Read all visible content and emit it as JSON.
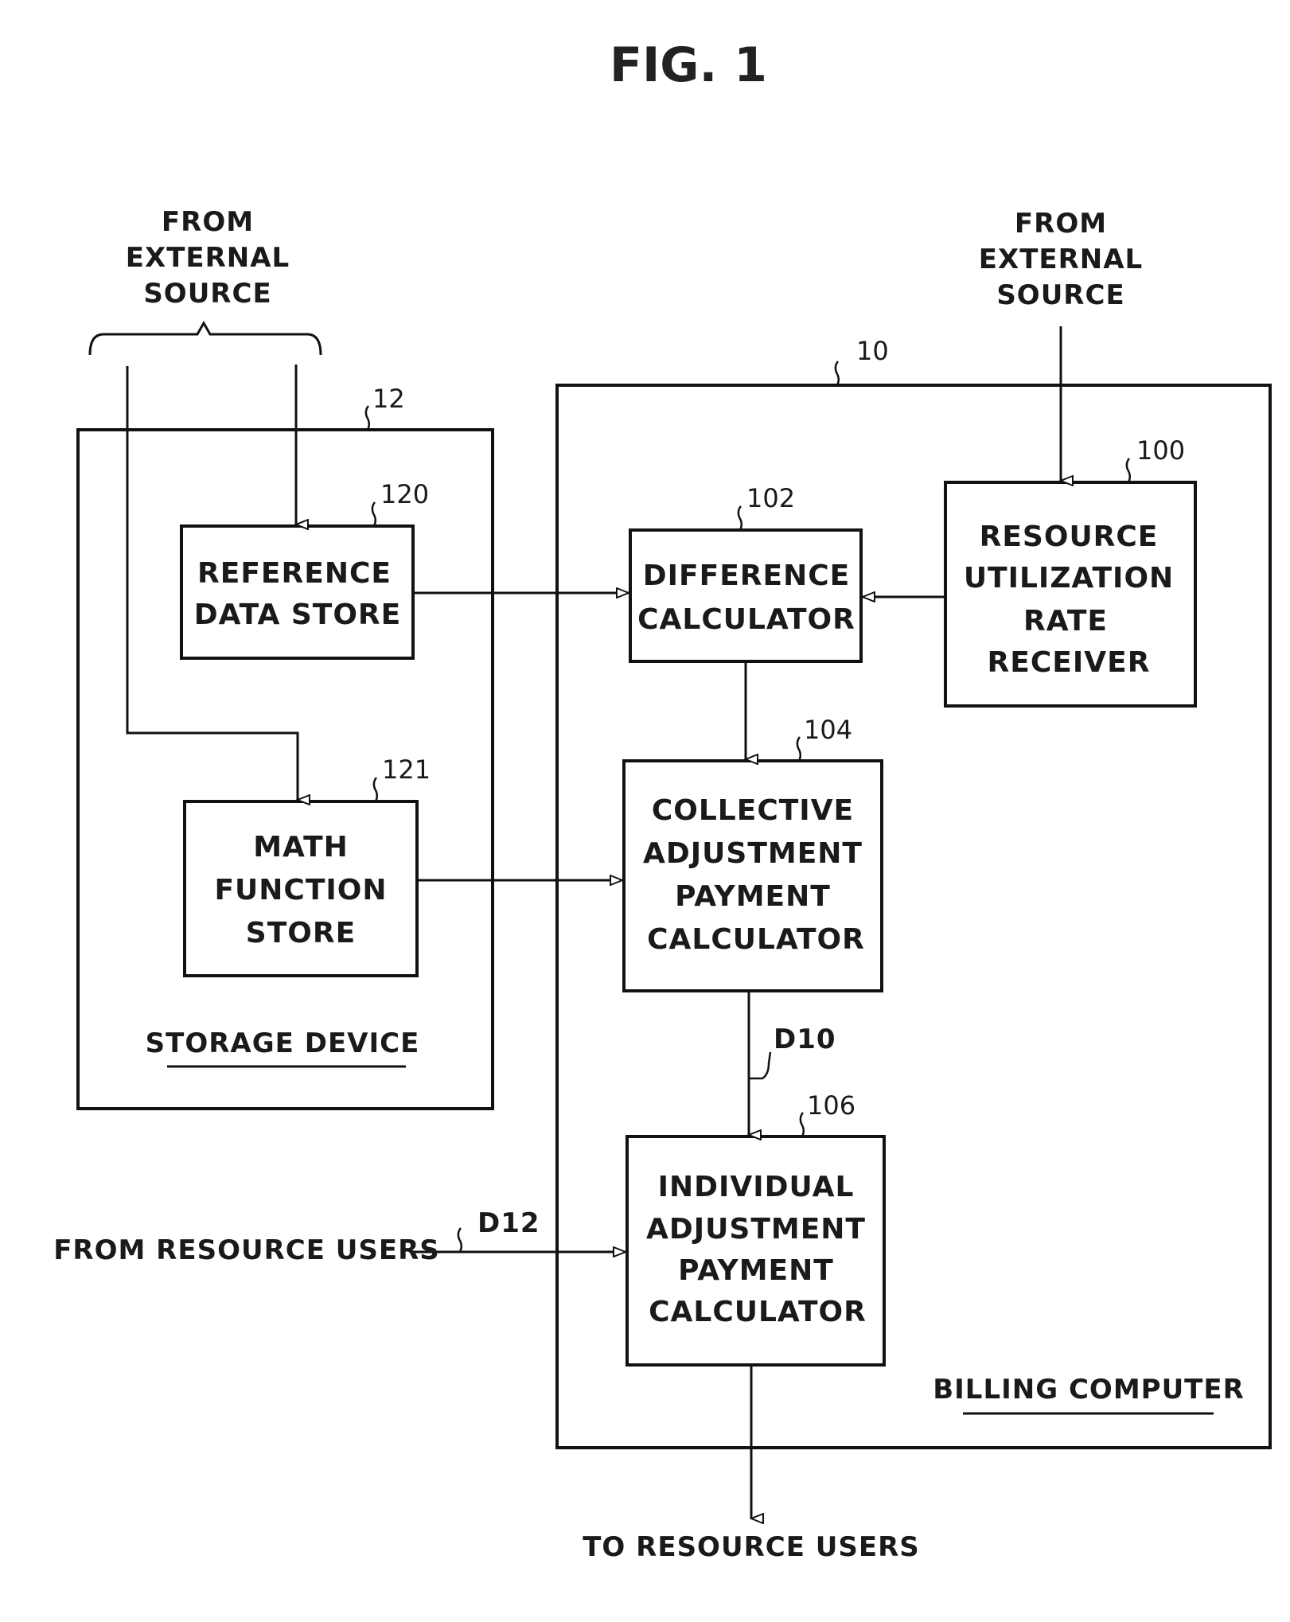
{
  "figure": {
    "title": "FIG. 1"
  },
  "external_sources": {
    "left": [
      "FROM",
      "EXTERNAL",
      "SOURCE"
    ],
    "right": [
      "FROM",
      "EXTERNAL",
      "SOURCE"
    ]
  },
  "containers": {
    "storage_device": {
      "ref": "12",
      "label": "STORAGE DEVICE"
    },
    "billing_computer": {
      "ref": "10",
      "label": "BILLING COMPUTER"
    }
  },
  "blocks": {
    "reference_data_store": {
      "ref": "120",
      "lines": [
        "REFERENCE",
        "DATA STORE"
      ]
    },
    "math_function_store": {
      "ref": "121",
      "lines": [
        "MATH",
        "FUNCTION",
        "STORE"
      ]
    },
    "resource_utilization_rate_receiver": {
      "ref": "100",
      "lines": [
        "RESOURCE",
        "UTILIZATION",
        "RATE",
        "RECEIVER"
      ]
    },
    "difference_calculator": {
      "ref": "102",
      "lines": [
        "DIFFERENCE",
        "CALCULATOR"
      ]
    },
    "collective_adjustment_payment_calculator": {
      "ref": "104",
      "lines": [
        "COLLECTIVE",
        "ADJUSTMENT",
        "PAYMENT",
        "CALCULATOR"
      ]
    },
    "individual_adjustment_payment_calculator": {
      "ref": "106",
      "lines": [
        "INDIVIDUAL",
        "ADJUSTMENT",
        "PAYMENT",
        "CALCULATOR"
      ]
    }
  },
  "signals": {
    "d10": "D10",
    "d12": "D12"
  },
  "io": {
    "from_resource_users": "FROM RESOURCE USERS",
    "to_resource_users": "TO RESOURCE USERS"
  }
}
